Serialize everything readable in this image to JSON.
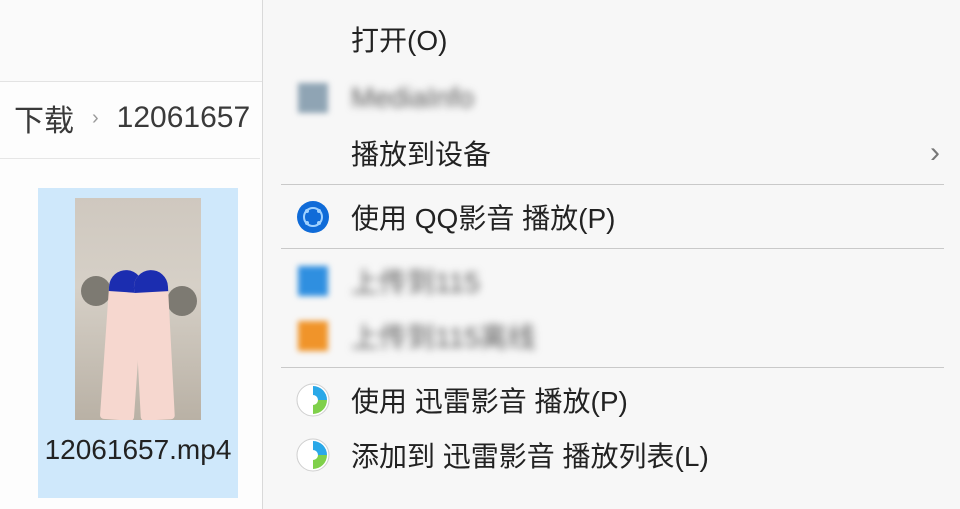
{
  "breadcrumb": {
    "segment1": "下载",
    "segment2": "12061657"
  },
  "file": {
    "name": "12061657.mp4"
  },
  "menu": {
    "open": "打开(O)",
    "mediainfo": "MediaInfo",
    "cast": "播放到设备",
    "qqplay": "使用 QQ影音 播放(P)",
    "upload115": "上传到115",
    "upload115_offline": "上传到115离线",
    "xl_play": "使用 迅雷影音 播放(P)",
    "xl_add": "添加到 迅雷影音 播放列表(L)"
  }
}
